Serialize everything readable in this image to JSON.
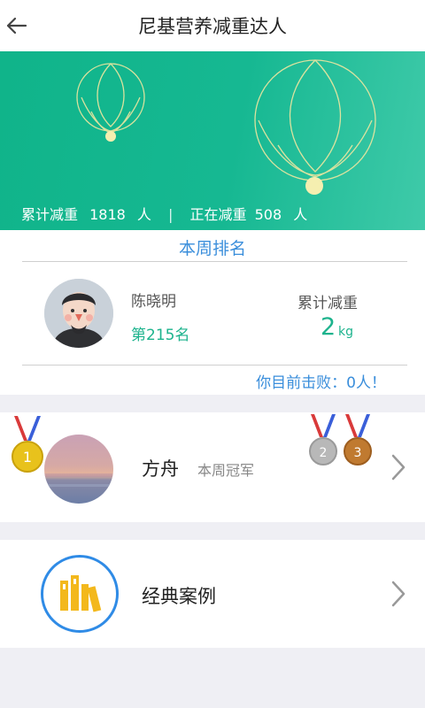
{
  "header": {
    "title": "尼基营养减重达人",
    "back_icon": "back-arrow-icon"
  },
  "banner": {
    "stat_total_label": "累计减重",
    "stat_total_value": "1818",
    "stat_total_unit": "人",
    "stat_separator": "|",
    "stat_current_label": "正在减重",
    "stat_current_value": "508",
    "stat_current_unit": "人",
    "colors": {
      "start": "#10b48a",
      "end": "#3fcaa9",
      "ornament": "#f0e7a0"
    }
  },
  "weekly_rank": {
    "title": "本周排名",
    "user_name": "陈晓明",
    "user_rank": "第215名",
    "total_label": "累计减重",
    "total_value": "2",
    "total_unit": "kg",
    "defeat_text": "你目前击败：0人！",
    "accent_color": "#1db38d",
    "link_color": "#3a8edb"
  },
  "champion": {
    "name": "方舟",
    "subtitle": "本周冠军",
    "medals": [
      {
        "label": "1",
        "icon": "gold-medal-icon"
      },
      {
        "label": "2",
        "icon": "silver-medal-icon"
      },
      {
        "label": "3",
        "icon": "bronze-medal-icon"
      }
    ]
  },
  "cases": {
    "label": "经典案例",
    "icon": "books-icon"
  }
}
